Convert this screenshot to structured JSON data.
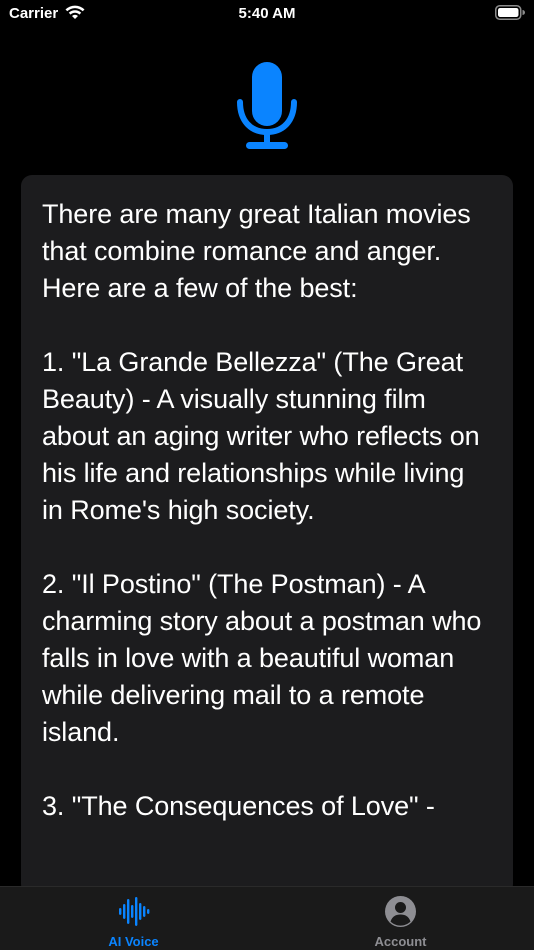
{
  "status_bar": {
    "carrier": "Carrier",
    "time": "5:40 AM",
    "wifi_icon": "wifi-icon",
    "battery_icon": "battery-icon"
  },
  "mic": {
    "icon": "microphone-icon",
    "color": "#0a84ff"
  },
  "response": {
    "text": "There are many great Italian movies that combine romance and anger. Here are a few of the best:\n\n1. \"La Grande Bellezza\" (The Great Beauty) - A visually stunning film about an aging writer who reflects on his life and relationships while living in Rome's high society.\n\n2. \"Il Postino\" (The Postman) - A charming story about a postman who falls in love with a beautiful woman while delivering mail to a remote island.\n\n3. \"The Consequences of Love\" -"
  },
  "tab_bar": {
    "tabs": [
      {
        "label": "AI Voice",
        "icon": "waveform-icon",
        "selected": true
      },
      {
        "label": "Account",
        "icon": "account-circle-icon",
        "selected": false
      }
    ],
    "active_color": "#0a84ff",
    "inactive_color": "#8e8e93"
  }
}
